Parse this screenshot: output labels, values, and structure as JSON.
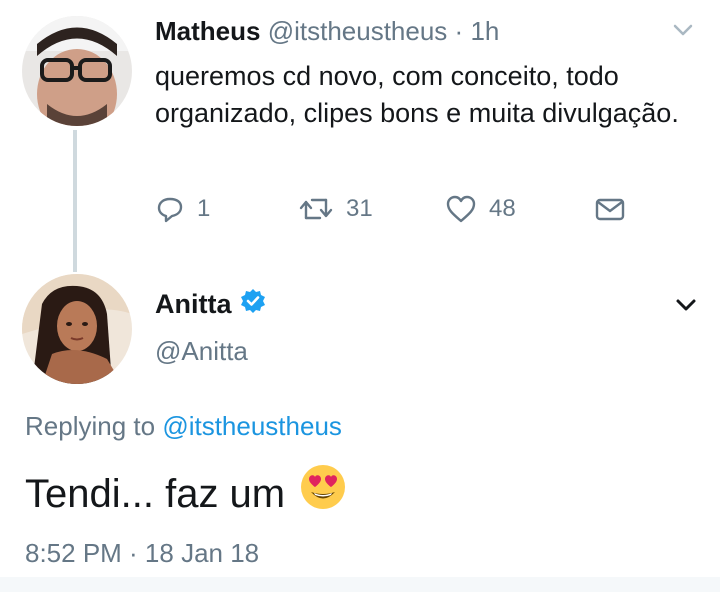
{
  "tweet1": {
    "name": "Matheus",
    "handle": "@itstheustheus",
    "separator": "·",
    "time": "1h",
    "text": "queremos cd novo, com conceito, todo organizado, clipes bons e muita divulgação.",
    "actions": {
      "reply": {
        "icon": "reply-icon",
        "count": "1"
      },
      "retweet": {
        "icon": "retweet-icon",
        "count": "31"
      },
      "like": {
        "icon": "heart-icon",
        "count": "48"
      },
      "dm": {
        "icon": "envelope-icon"
      }
    }
  },
  "tweet2": {
    "name": "Anitta",
    "verified": true,
    "handle": "@Anitta",
    "replying_prefix": "Replying to",
    "replying_handle": "@itstheustheus",
    "text": "Tendi... faz um",
    "emoji": "heart-eyes-emoji",
    "timestamp": "8:52 PM · 18 Jan 18"
  },
  "colors": {
    "muted": "#657786",
    "link": "#1b95e0",
    "verified": "#1da1f2",
    "thread_line": "#cfd9de"
  }
}
